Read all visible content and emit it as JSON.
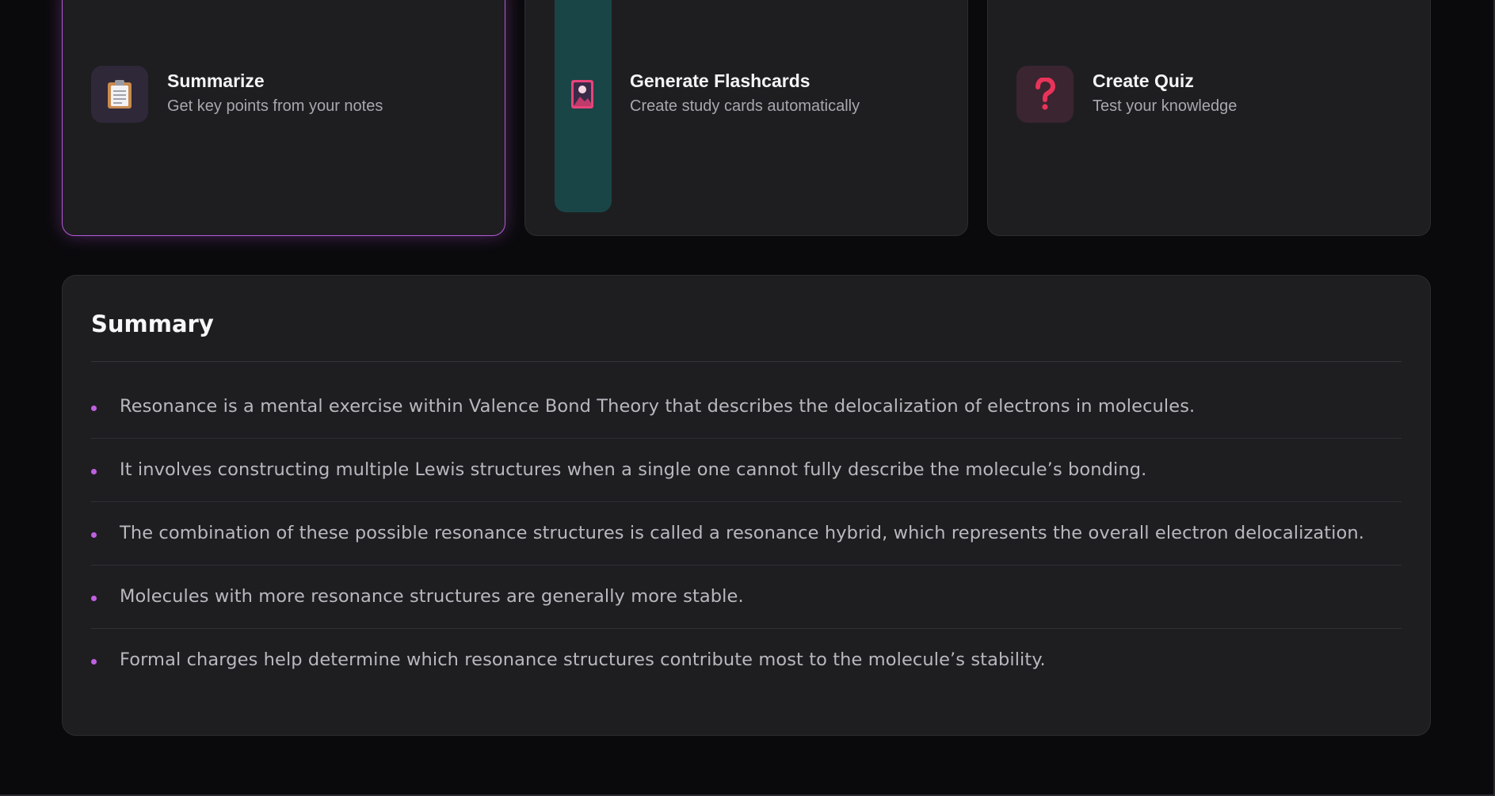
{
  "actions": [
    {
      "title": "Summarize",
      "subtitle": "Get key points from your notes",
      "icon": "clipboard-icon",
      "active": true
    },
    {
      "title": "Generate Flashcards",
      "subtitle": "Create study cards automatically",
      "icon": "flashcard-icon",
      "active": false
    },
    {
      "title": "Create Quiz",
      "subtitle": "Test your knowledge",
      "icon": "question-mark-icon",
      "active": false
    }
  ],
  "summary": {
    "title": "Summary",
    "items": [
      "Resonance is a mental exercise within Valence Bond Theory that describes the delocalization of electrons in molecules.",
      "It involves constructing multiple Lewis structures when a single one cannot fully describe the molecule’s bonding.",
      "The combination of these possible resonance structures is called a resonance hybrid, which represents the overall electron delocalization.",
      "Molecules with more resonance structures are generally more stable.",
      "Formal charges help determine which resonance structures contribute most to the molecule’s stability."
    ]
  },
  "colors": {
    "accent": "#b45ad6",
    "bullet": "#c060e0",
    "background": "#0a0a0c",
    "card": "#1e1e21",
    "teal": "#1a4546",
    "quiz_red": "#e8335a"
  }
}
